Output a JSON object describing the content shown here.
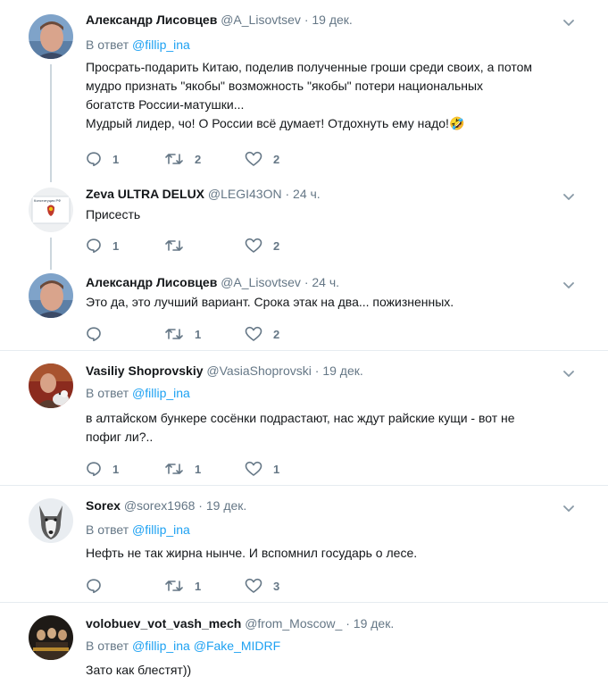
{
  "tweets": [
    {
      "name": "Александр Лисовцев",
      "handle": "@A_Lisovtsev",
      "time": "19 дек.",
      "reply_prefix": "В ответ",
      "mentions": [
        "@fillip_ina"
      ],
      "lines": [
        "Просрать-подарить Китаю, поделив полученные гроши среди своих, а потом",
        "мудро признать \"якобы\" возможность \"якобы\" потери национальных",
        "богатств России-матушки...",
        "Мудрый лидер, чо! О России всё думает! Отдохнуть ему надо!🤣"
      ],
      "replies": "1",
      "retweets": "2",
      "likes": "2"
    },
    {
      "name": "Zeva ULTRA DELUX",
      "handle": "@LEGI43ON",
      "time": "24 ч.",
      "lines": [
        "Присесть"
      ],
      "replies": "1",
      "retweets": "",
      "likes": "2"
    },
    {
      "name": "Александр Лисовцев",
      "handle": "@A_Lisovtsev",
      "time": "24 ч.",
      "lines": [
        "Это да, это лучший вариант. Срока этак на два... пожизненных."
      ],
      "replies": "",
      "retweets": "1",
      "likes": "2"
    },
    {
      "name": "Vasiliy Shoprovskiy",
      "handle": "@VasiaShoprovski",
      "time": "19 дек.",
      "reply_prefix": "В ответ",
      "mentions": [
        "@fillip_ina"
      ],
      "lines": [
        "в алтайском бункере сосёнки подрастают, нас ждут райские кущи - вот не",
        "пофиг ли?.."
      ],
      "replies": "1",
      "retweets": "1",
      "likes": "1"
    },
    {
      "name": "Sorex",
      "handle": "@sorex1968",
      "time": "19 дек.",
      "reply_prefix": "В ответ",
      "mentions": [
        "@fillip_ina"
      ],
      "lines": [
        "Нефть не так жирна нынче. И вспомнил государь о лесе."
      ],
      "replies": "",
      "retweets": "1",
      "likes": "3"
    },
    {
      "name": "volobuev_vot_vash_mech",
      "handle": "@from_Moscow_",
      "time": "19 дек.",
      "reply_prefix": "В ответ",
      "mentions": [
        "@fillip_ina",
        "@Fake_MIDRF"
      ],
      "lines": [
        "Зато как блестят))"
      ]
    }
  ],
  "avatar_badge_text": "Конституция РФ",
  "colors": {
    "link": "#1da1f2",
    "muted": "#657786",
    "separator": "#e6ecf0",
    "thread_line": "#ccd6dd"
  },
  "icons": {
    "reply": "reply-icon",
    "retweet": "retweet-icon",
    "like": "heart-icon",
    "menu": "chevron-down-icon"
  }
}
